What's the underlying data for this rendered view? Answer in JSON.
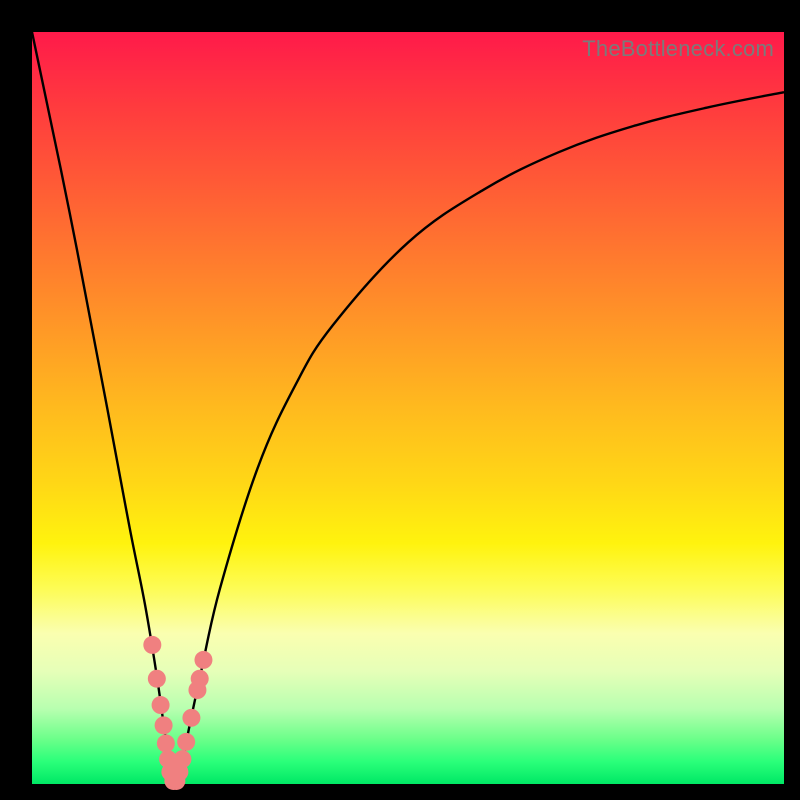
{
  "watermark": "TheBottleneck.com",
  "colors": {
    "frame": "#000000",
    "gradient_top": "#ff1a4a",
    "gradient_bottom": "#00e865",
    "curve": "#000000",
    "marker": "#f08080"
  },
  "chart_data": {
    "type": "line",
    "title": "",
    "xlabel": "",
    "ylabel": "",
    "xlim": [
      0,
      100
    ],
    "ylim": [
      0,
      100
    ],
    "series": [
      {
        "name": "bottleneck-curve",
        "x": [
          0,
          5,
          10,
          13,
          15,
          16.5,
          17.5,
          18.2,
          18.8,
          19.2,
          20,
          21,
          22.5,
          25,
          30,
          35,
          40,
          50,
          60,
          70,
          80,
          90,
          100
        ],
        "values": [
          100,
          76,
          50,
          34,
          24,
          15,
          8,
          3,
          0,
          0,
          3,
          8,
          15,
          26,
          42,
          53,
          61,
          72,
          79,
          84,
          87.5,
          90,
          92
        ]
      }
    ],
    "markers": {
      "name": "highlighted-points",
      "color": "#f08080",
      "points": [
        {
          "x": 16.0,
          "y": 18.5
        },
        {
          "x": 16.6,
          "y": 14.0
        },
        {
          "x": 17.1,
          "y": 10.5
        },
        {
          "x": 17.5,
          "y": 7.8
        },
        {
          "x": 17.8,
          "y": 5.4
        },
        {
          "x": 18.1,
          "y": 3.3
        },
        {
          "x": 18.4,
          "y": 1.6
        },
        {
          "x": 18.8,
          "y": 0.4
        },
        {
          "x": 19.2,
          "y": 0.4
        },
        {
          "x": 19.6,
          "y": 1.6
        },
        {
          "x": 20.0,
          "y": 3.3
        },
        {
          "x": 20.5,
          "y": 5.6
        },
        {
          "x": 21.2,
          "y": 8.8
        },
        {
          "x": 22.0,
          "y": 12.5
        },
        {
          "x": 22.3,
          "y": 14.0
        },
        {
          "x": 22.8,
          "y": 16.5
        }
      ]
    }
  }
}
